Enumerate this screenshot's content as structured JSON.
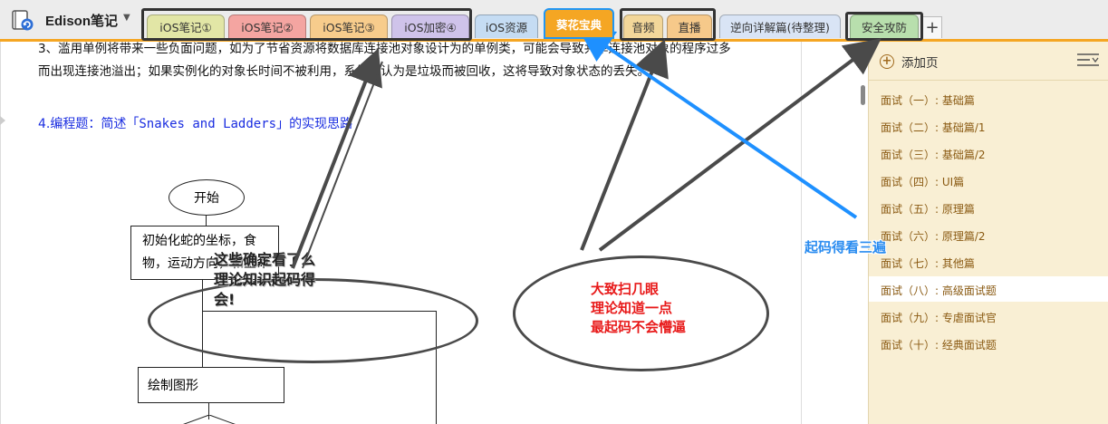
{
  "toolbar": {
    "notebook_title": "Edison笔记",
    "tabs": [
      {
        "label": "iOS笔记①",
        "color": "#e2e6a6"
      },
      {
        "label": "iOS笔记②",
        "color": "#f4a5a1"
      },
      {
        "label": "iOS笔记③",
        "color": "#f7cc8c"
      },
      {
        "label": "iOS加密④",
        "color": "#cfc3ea"
      },
      {
        "label": "iOS资源",
        "color": "#c5dcf3"
      },
      {
        "label": "葵花宝典",
        "color": "#f5a623"
      },
      {
        "label": "音频",
        "color": "#f3d79a"
      },
      {
        "label": "直播",
        "color": "#f6c98a"
      },
      {
        "label": "逆向详解篇(待整理)",
        "color": "#d9e4f5"
      },
      {
        "label": "安全攻防",
        "color": "#b8dfad"
      }
    ],
    "add_tab": "+",
    "accent": "#f5a623"
  },
  "content": {
    "para_line1": "3、滥用单例将带来一些负面问题，如为了节省资源将数据库连接池对象设计为的单例类，可能会导致共享连接池对象的程序过多",
    "para_line2": "而出现连接池溢出；如果实例化的对象长时间不被利用，系统会认为是垃圾而被回收，这将导致对象状态的丢失。",
    "heading_prefix": "4.编程题：简述「",
    "heading_code": "Snakes and Ladders",
    "heading_suffix": "」的实现思路",
    "flowchart": {
      "start": "开始",
      "box1_line1": "初始化蛇的坐标，食",
      "box1_line2": "物，运动方向，和生命",
      "box2": "绘制图形"
    }
  },
  "annotations": {
    "note1_lines": [
      "这些确定看了么",
      "理论知识起码得",
      "会!"
    ],
    "note2_lines": [
      "大致扫几眼",
      "理论知道一点",
      "最起码不会懵逼"
    ],
    "note3": "起码得看三遍",
    "note2_color": "#e81a1a",
    "note3_color": "#2a8cf0"
  },
  "sidebar": {
    "add_page": "添加页",
    "pages": [
      "面试（一）: 基础篇",
      "面试（二）: 基础篇/1",
      "面试（三）: 基础篇/2",
      "面试（四）: UI篇",
      "面试（五）: 原理篇",
      "面试（六）: 原理篇/2",
      "面试（七）: 其他篇",
      "面试（八）: 高级面试题",
      "面试（九）: 专虐面试官",
      "面试（十）: 经典面试题"
    ],
    "selected_index": 7,
    "background": "#f9efd4"
  }
}
